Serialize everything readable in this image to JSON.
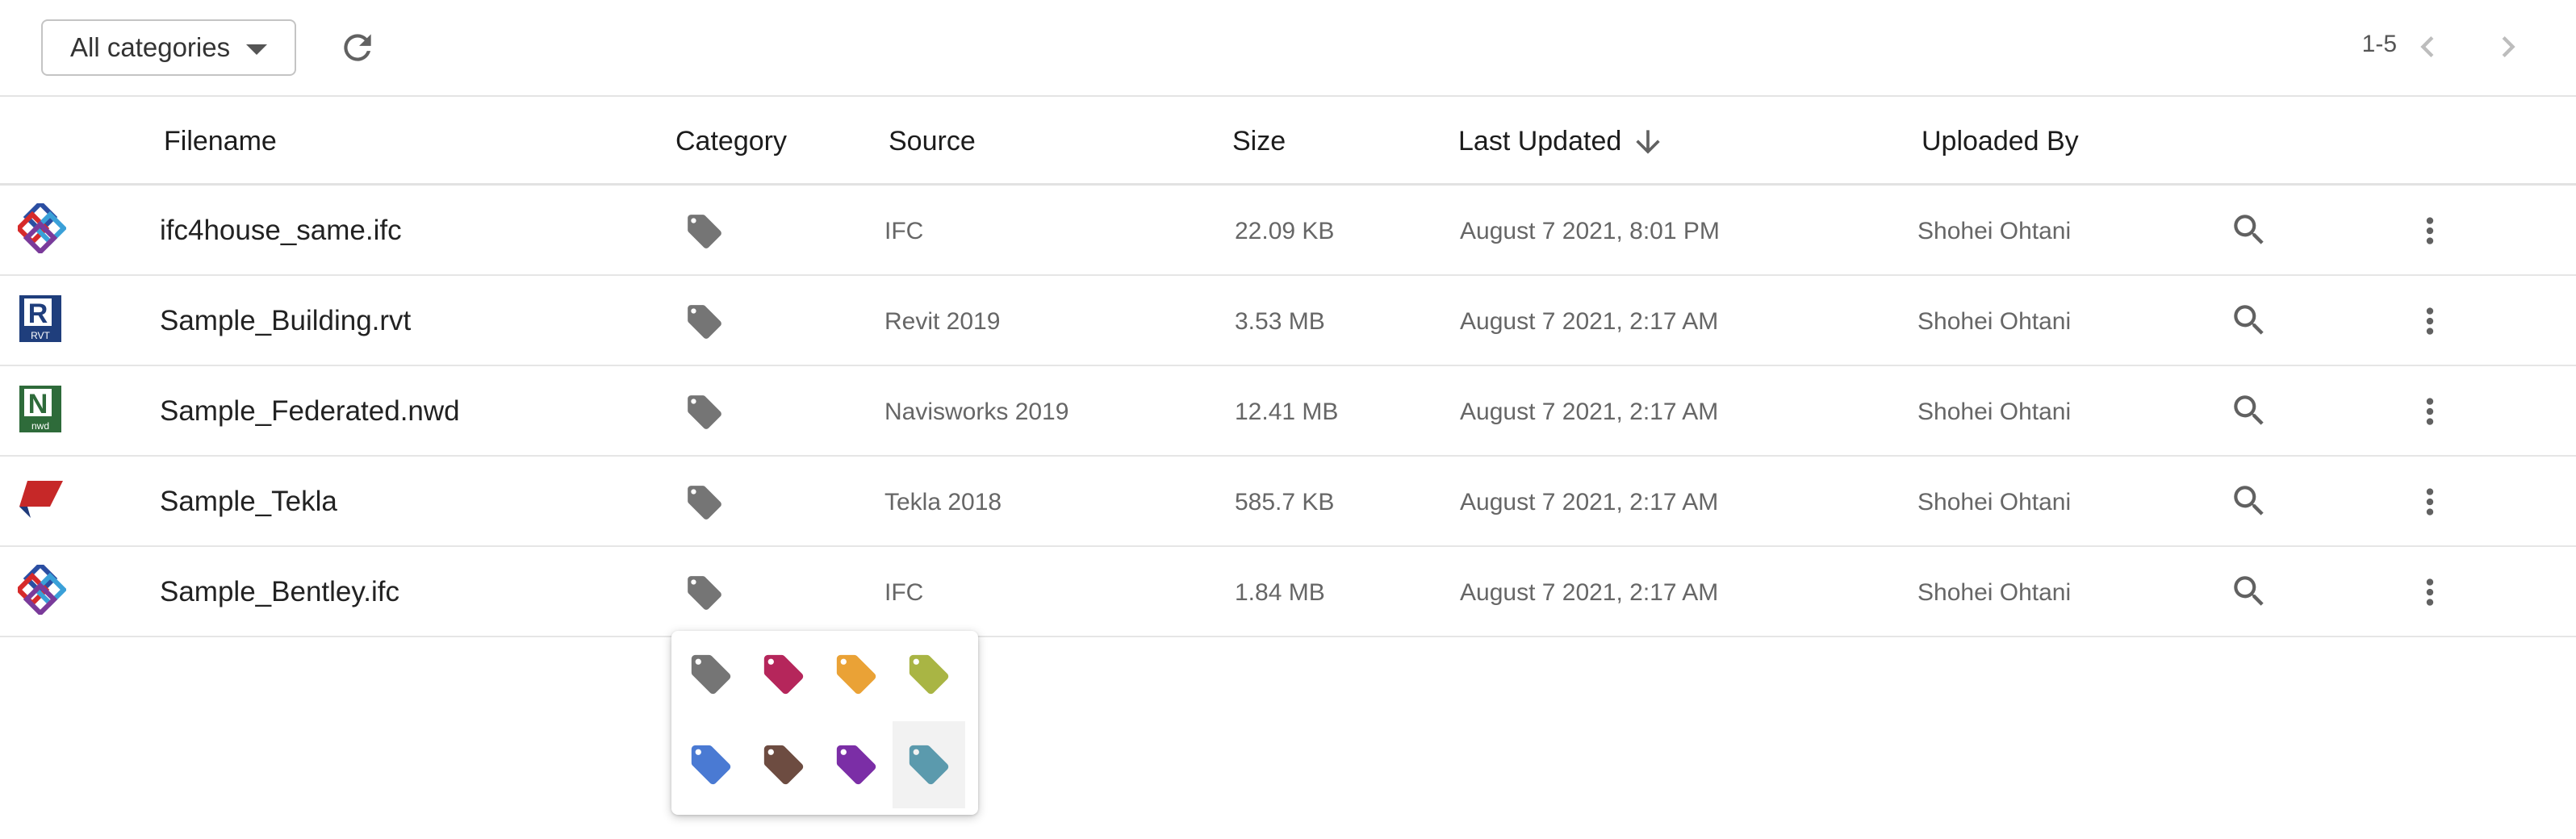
{
  "toolbar": {
    "category_filter": "All categories",
    "pager_range": "1-5"
  },
  "table": {
    "columns": {
      "filename": "Filename",
      "category": "Category",
      "source": "Source",
      "size": "Size",
      "last_updated": "Last Updated",
      "uploaded_by": "Uploaded By"
    },
    "sort": {
      "column": "last_updated",
      "direction": "descending"
    },
    "rows": [
      {
        "filename": "ifc4house_same.ifc",
        "file_type": "ifc",
        "source": "IFC",
        "size": "22.09 KB",
        "last_updated": "August 7 2021, 8:01 PM",
        "uploaded_by": "Shohei Ohtani",
        "category_color": "#757575"
      },
      {
        "filename": "Sample_Building.rvt",
        "file_type": "rvt",
        "file_badge": "RVT",
        "source": "Revit 2019",
        "size": "3.53 MB",
        "last_updated": "August 7 2021, 2:17 AM",
        "uploaded_by": "Shohei Ohtani",
        "category_color": "#757575"
      },
      {
        "filename": "Sample_Federated.nwd",
        "file_type": "nwd",
        "file_badge": "nwd",
        "source": "Navisworks 2019",
        "size": "12.41 MB",
        "last_updated": "August 7 2021, 2:17 AM",
        "uploaded_by": "Shohei Ohtani",
        "category_color": "#757575"
      },
      {
        "filename": "Sample_Tekla",
        "file_type": "tekla",
        "source": "Tekla 2018",
        "size": "585.7 KB",
        "last_updated": "August 7 2021, 2:17 AM",
        "uploaded_by": "Shohei Ohtani",
        "category_color": "#757575"
      },
      {
        "filename": "Sample_Bentley.ifc",
        "file_type": "ifc",
        "source": "IFC",
        "size": "1.84 MB",
        "last_updated": "August 7 2021, 2:17 AM",
        "uploaded_by": "Shohei Ohtani",
        "category_color": "#757575"
      }
    ]
  },
  "category_picker": {
    "colors": [
      "#757575",
      "#b5265b",
      "#eaa236",
      "#a9b544",
      "#4a7ad3",
      "#6d4c41",
      "#7b2ea6",
      "#5b9aad"
    ],
    "hovered_index": 7
  }
}
